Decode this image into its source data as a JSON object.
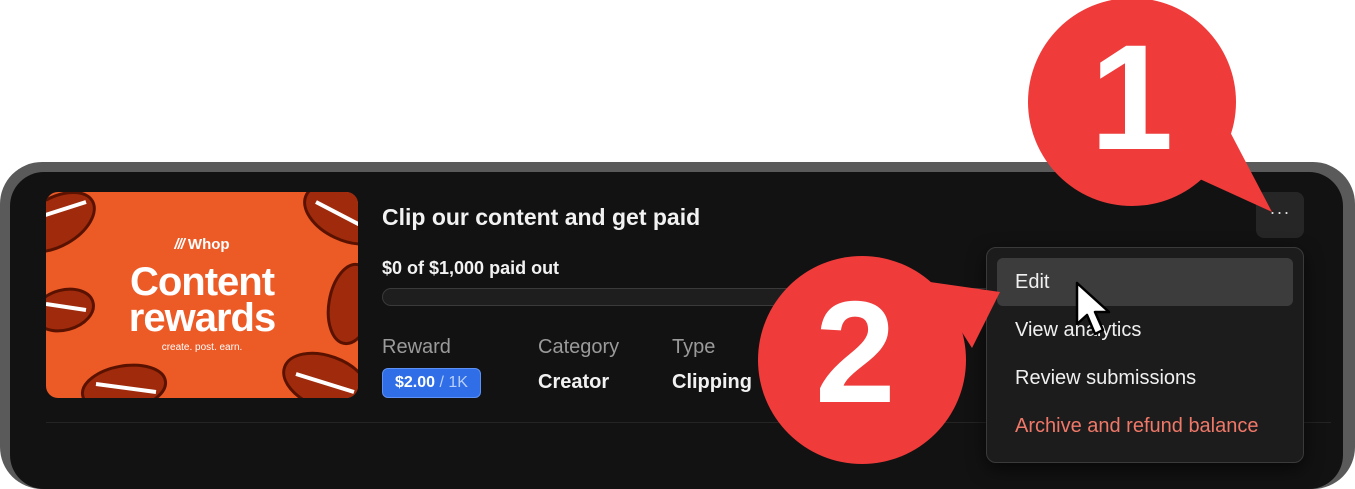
{
  "listing": {
    "title": "Clip our content and get paid",
    "paid_summary": "$0 of $1,000 paid out",
    "progress_fraction": 0.0,
    "thumbnail": {
      "brand": "Whop",
      "headline_line1": "Content",
      "headline_line2": "rewards",
      "tagline": "create. post. earn."
    },
    "reward_label": "Reward",
    "reward_value": "$2.00",
    "reward_unit": "/ 1K",
    "category_label": "Category",
    "category_value": "Creator",
    "type_label": "Type",
    "type_value": "Clipping",
    "more_button": "···"
  },
  "menu": {
    "items": [
      {
        "label": "Edit"
      },
      {
        "label": "View analytics"
      },
      {
        "label": "Review submissions"
      },
      {
        "label": "Archive and refund balance"
      }
    ]
  },
  "annotations": {
    "marker1": "1",
    "marker2": "2",
    "marker_color": "#ef3b3a"
  },
  "colors": {
    "card_bg": "#121212",
    "accent_blue": "#2f6ee6",
    "thumbnail_orange": "#ec5a26",
    "danger": "#f07868"
  }
}
